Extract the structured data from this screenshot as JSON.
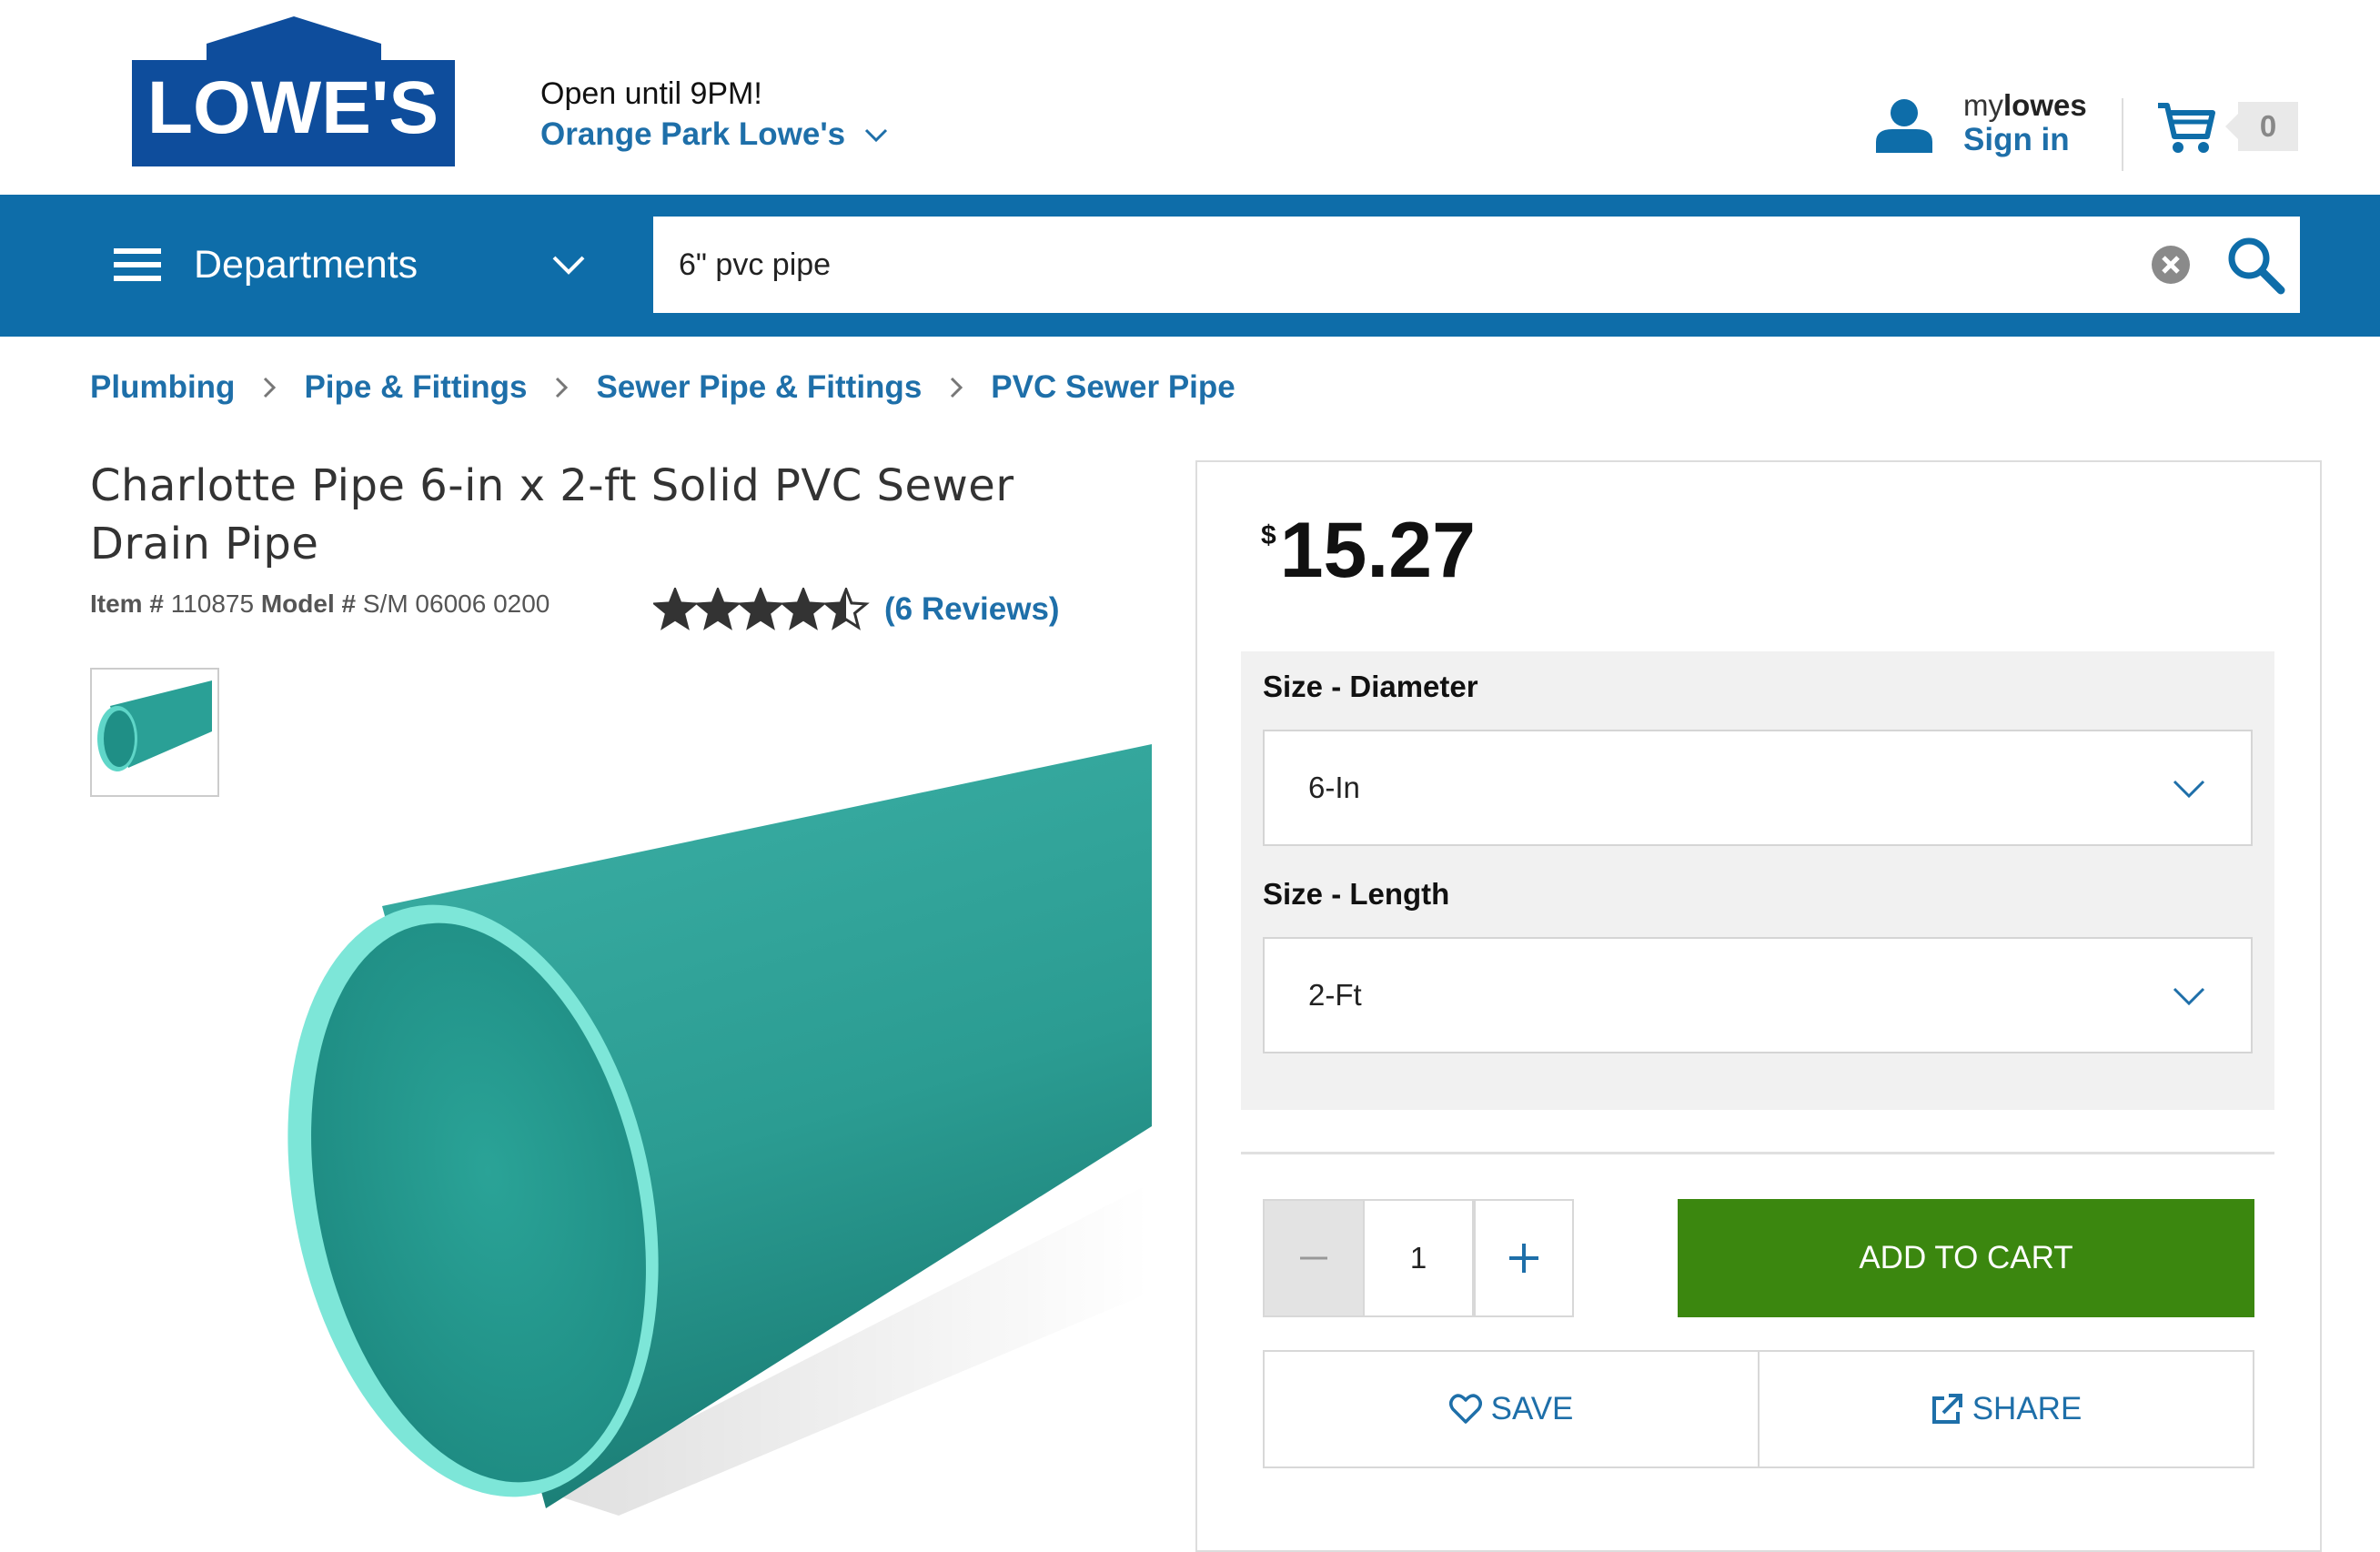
{
  "brand": {
    "logo_text": "LOWE'S",
    "color": "#0e4d9c"
  },
  "header": {
    "store_status": "Open until 9PM!",
    "store_name": "Orange Park Lowe's",
    "account_prefix": "my",
    "account_brand": "lowes",
    "sign_in": "Sign in",
    "cart_count": "0"
  },
  "nav": {
    "departments": "Departments",
    "search_value": "6\" pvc pipe",
    "color": "#0e6da9"
  },
  "breadcrumb": [
    "Plumbing",
    "Pipe & Fittings",
    "Sewer Pipe & Fittings",
    "PVC Sewer Pipe"
  ],
  "product": {
    "title": "Charlotte Pipe 6-in x 2-ft Solid PVC Sewer Drain Pipe",
    "item_label": "Item #",
    "item_number": "110875",
    "model_label": "Model #",
    "model_number": "S/M 06006 0200",
    "rating": 4.5,
    "rating_max": 5,
    "reviews": "(6 Reviews)",
    "pipe_color": "#2fa39a"
  },
  "buybox": {
    "currency": "$",
    "price": "15.27",
    "diameter_label": "Size - Diameter",
    "diameter_value": "6-In",
    "length_label": "Size - Length",
    "length_value": "2-Ft",
    "quantity": "1",
    "add_to_cart": "ADD TO CART",
    "save": "SAVE",
    "share": "SHARE",
    "cart_button_color": "#3b870f"
  }
}
